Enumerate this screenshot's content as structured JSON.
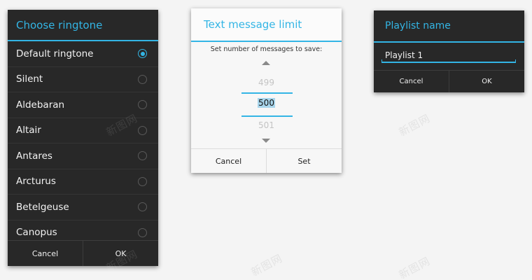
{
  "ringtone_dialog": {
    "title": "Choose ringtone",
    "items": [
      {
        "label": "Default ringtone",
        "selected": true
      },
      {
        "label": "Silent",
        "selected": false
      },
      {
        "label": "Aldebaran",
        "selected": false
      },
      {
        "label": "Altair",
        "selected": false
      },
      {
        "label": "Antares",
        "selected": false
      },
      {
        "label": "Arcturus",
        "selected": false
      },
      {
        "label": "Betelgeuse",
        "selected": false
      },
      {
        "label": "Canopus",
        "selected": false
      }
    ],
    "cancel_label": "Cancel",
    "ok_label": "OK"
  },
  "limit_dialog": {
    "title": "Text message limit",
    "message": "Set number of messages to save:",
    "prev_value": "499",
    "current_value": "500",
    "next_value": "501",
    "cancel_label": "Cancel",
    "set_label": "Set"
  },
  "playlist_dialog": {
    "title": "Playlist name",
    "input_value": "Playlist 1",
    "cancel_label": "Cancel",
    "ok_label": "OK"
  },
  "watermark": "新图网",
  "colors": {
    "accent": "#33b5e5",
    "dark_background": "#282828",
    "light_background": "#f7f7f7",
    "page_background": "#f4f4f4"
  }
}
